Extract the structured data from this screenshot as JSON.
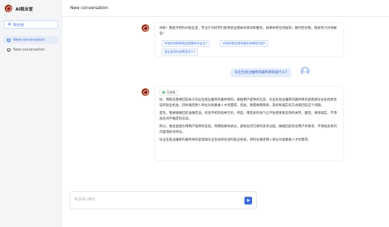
{
  "sidebar": {
    "brand_title": "AI就业宣",
    "new_chat_label": "新对话",
    "conversations": [
      {
        "label": "New conversation",
        "active": true
      },
      {
        "label": "New conversation",
        "active": false
      }
    ]
  },
  "header": {
    "title": "New conversation"
  },
  "messages": {
    "greeting": {
      "text": "你好！我是学校的AI就业宣，专注于为同学们提供就业相关的资讯和服务。如果你有任何疑问，随时告诉我，我会尽力为你解答！",
      "suggestions": [
        "学校如何帮助就业困难的毕业生?",
        "学校的就业指导服务有哪些内容?",
        "就业指导的收费是多少?"
      ]
    },
    "user_question": "毕业生就业推荐的最终目的是什么?",
    "answer": {
      "status_label": "已完成",
      "paragraphs": [
        "好，我现在需要回答关于毕业生就业推荐的最终目的。根据用户提供的信息，毕业生就业推荐的最终目的是帮助毕业生找到合适的就业机会，同时满足用人单位对高素质人才的需求。因此，我需要用简单、友好和诚实的方式来回答这个问题。",
        "首先，我要确保回答准确无误，符合学校的指导方针。然后，用友好的语气让学生感受到支持和关怀。最后，保持诚实，不添加任何不确定的信息。",
        "所以，我会直接引用用户提供的答案，简明扼要地表达，避免任何冗余的思考过程。确保回答符合用户的要求，不添加多余的内容或标点符号。",
        "毕业生就业推荐的最终目的是帮助毕业生找到合适的就业机会，同时也满足用人单位对高素质人才的需求。"
      ]
    }
  },
  "input": {
    "placeholder": "有话请入聊天",
    "value": ""
  },
  "colors": {
    "accent": "#3e6fd8",
    "brand": "#8c1b1b",
    "success": "#31a45a",
    "user_bubble": "#e3ecfb"
  }
}
